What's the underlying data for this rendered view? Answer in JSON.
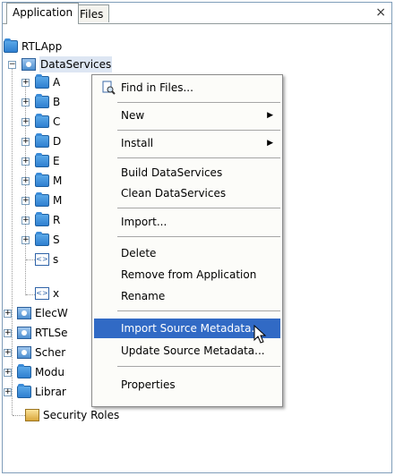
{
  "tabs": [
    {
      "label": "Application",
      "active": true
    },
    {
      "label": "Files",
      "active": false
    }
  ],
  "close_label": "×",
  "tree": {
    "root": "RTLApp",
    "dataservices": "DataServices",
    "children": [
      {
        "label": "A",
        "icon": "folder-icon"
      },
      {
        "label": "B",
        "icon": "folder-icon"
      },
      {
        "label": "C",
        "icon": "folder-icon"
      },
      {
        "label": "D",
        "icon": "folder-icon"
      },
      {
        "label": "E",
        "icon": "folder-icon"
      },
      {
        "label": "M",
        "icon": "folder-icon"
      },
      {
        "label": "M",
        "icon": "folder-icon"
      },
      {
        "label": "R",
        "icon": "folder-icon"
      },
      {
        "label": "S",
        "icon": "folder-icon"
      },
      {
        "label": "s",
        "icon": "file-icon"
      },
      {
        "label": "x",
        "icon": "file-icon"
      }
    ],
    "top_items": [
      {
        "label": "ElecW",
        "icon": "database-icon"
      },
      {
        "label": "RTLSe",
        "icon": "database-icon"
      },
      {
        "label": "Scher",
        "icon": "schema-icon"
      },
      {
        "label": "Modu",
        "icon": "folder-icon"
      },
      {
        "label": "Librar",
        "icon": "folder-icon"
      },
      {
        "label": "Security Roles",
        "icon": "security-roles-icon"
      }
    ]
  },
  "menu": {
    "items": [
      {
        "label": "Find in Files...",
        "has_icon": true
      },
      {
        "label": "New",
        "submenu": true
      },
      {
        "label": "Install",
        "submenu": true
      },
      {
        "label": "Build DataServices"
      },
      {
        "label": "Clean DataServices"
      },
      {
        "label": "Import..."
      },
      {
        "label": "Delete"
      },
      {
        "label": "Remove from Application"
      },
      {
        "label": "Rename"
      },
      {
        "label": "Import Source Metadata...",
        "highlighted": true
      },
      {
        "label": "Update Source Metadata..."
      },
      {
        "label": "Properties"
      }
    ],
    "submenu_arrow": "▶"
  },
  "colors": {
    "highlight": "#316ac5",
    "border": "#7f9db9",
    "folder": "#2f7fd0"
  }
}
